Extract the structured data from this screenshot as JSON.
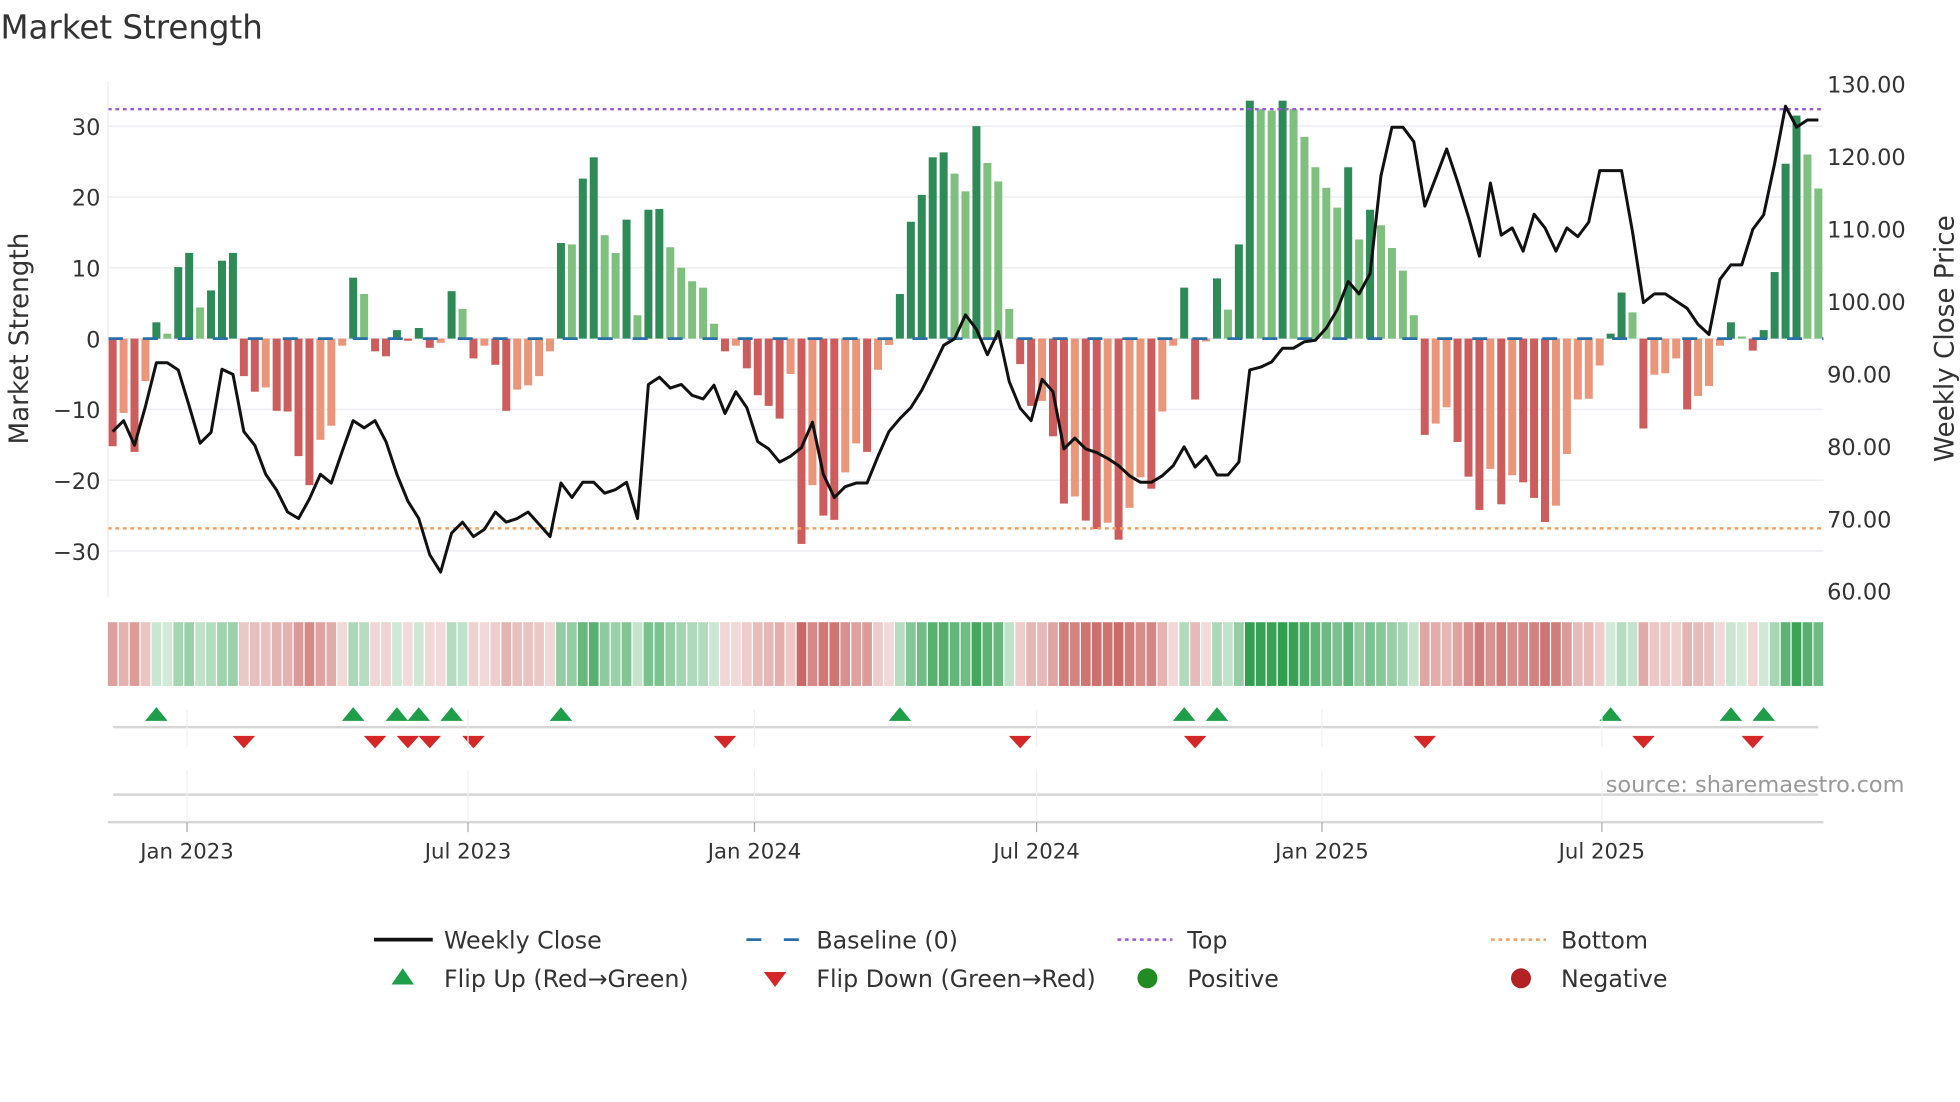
{
  "chart_data": {
    "type": "bar",
    "title": "Market Strength",
    "ylabel": "Market Strength",
    "y2label": "Weekly Close Price",
    "ylim": [
      -36,
      36
    ],
    "y2lim": [
      60,
      130
    ],
    "y_ticks": [
      -30,
      -20,
      -10,
      0,
      10,
      20,
      30
    ],
    "y2_ticks": [
      "60.00",
      "70.00",
      "80.00",
      "90.00",
      "100.00",
      "110.00",
      "120.00",
      "130.00"
    ],
    "x_ticks": [
      {
        "label": "Jan 2023",
        "week": 6.8
      },
      {
        "label": "Jul 2023",
        "week": 32.5
      },
      {
        "label": "Jan 2024",
        "week": 58.7
      },
      {
        "label": "Jul 2024",
        "week": 84.5
      },
      {
        "label": "Jan 2025",
        "week": 110.6
      },
      {
        "label": "Jul 2025",
        "week": 136.2
      }
    ],
    "top_level": 32.4,
    "bottom_level": -26.8,
    "baseline": 0,
    "strength": [
      -15.2,
      -10.5,
      -16,
      -6,
      2.3,
      0.7,
      10.1,
      12.1,
      4.4,
      6.8,
      11,
      12.1,
      -5.3,
      -7.5,
      -6.9,
      -10.2,
      -10.3,
      -16.6,
      -20.7,
      -14.3,
      -12.3,
      -1,
      8.6,
      6.3,
      -1.8,
      -2.5,
      1.2,
      -0.3,
      1.5,
      -1.3,
      -0.6,
      6.7,
      4.2,
      -2.8,
      -1,
      -3.7,
      -10.2,
      -7.2,
      -6.6,
      -5.3,
      -1.8,
      13.5,
      13.3,
      22.6,
      25.6,
      14.6,
      12.1,
      16.8,
      3.3,
      18.2,
      18.3,
      12.9,
      10,
      8.1,
      7.2,
      2.1,
      -1.8,
      -1,
      -4.2,
      -8,
      -9.5,
      -11.3,
      -5,
      -29,
      -20.7,
      -25,
      -25.6,
      -18.9,
      -14.8,
      -16,
      -4.4,
      -0.9,
      6.3,
      16.5,
      20.3,
      25.6,
      26.3,
      23.3,
      20.8,
      30,
      24.8,
      22.2,
      4.2,
      -3.6,
      -9.5,
      -8.8,
      -13.8,
      -23.3,
      -22.3,
      -25.7,
      -26.9,
      -26,
      -28.4,
      -23.9,
      -19.6,
      -21.2,
      -10.3,
      -1,
      7.2,
      -8.6,
      -0.4,
      8.5,
      4.1,
      13.3,
      33.6,
      32.4,
      32.2,
      33.6,
      32.4,
      28.5,
      24.2,
      21.3,
      18.5,
      24.2,
      14,
      18.2,
      16,
      12.8,
      9.6,
      3.3,
      -13.6,
      -12,
      -9.7,
      -14.6,
      -19.5,
      -24.2,
      -18.4,
      -23.4,
      -19.3,
      -20.3,
      -22.5,
      -25.9,
      -23.6,
      -16.3,
      -8.6,
      -8.5,
      -3.8,
      0.7,
      6.5,
      3.7,
      -12.7,
      -5.1,
      -4.9,
      -2.8,
      -10,
      -8.1,
      -6.7,
      -1,
      2.3,
      0.3,
      -1.7,
      1.2,
      9.4,
      24.7,
      31.5,
      26,
      21.2
    ],
    "weekly_close": [
      82,
      83.5,
      80.1,
      85.5,
      91.5,
      91.5,
      90.5,
      85.5,
      80.4,
      81.9,
      90.6,
      89.9,
      82,
      80.1,
      76.1,
      73.9,
      70.9,
      70,
      72.7,
      76.1,
      74.9,
      79.3,
      83.5,
      82.5,
      83.5,
      80.6,
      76.1,
      72.4,
      70,
      65,
      62.6,
      68,
      69.5,
      67.5,
      68.5,
      70.9,
      69.5,
      70,
      70.9,
      69.2,
      67.5,
      74.9,
      72.9,
      75,
      75,
      73.5,
      74,
      75,
      70,
      88.5,
      89.5,
      88,
      88.5,
      87,
      86.5,
      88.4,
      84.5,
      87.5,
      85.3,
      80.6,
      79.6,
      77.8,
      78.6,
      79.8,
      83.3,
      76.1,
      72.9,
      74.4,
      74.9,
      74.9,
      78.6,
      82,
      83.8,
      85.3,
      87.7,
      90.7,
      93.9,
      94.8,
      98.1,
      96.1,
      92.6,
      95.8,
      88.9,
      85.2,
      83.5,
      89.2,
      87.5,
      79.6,
      81.1,
      79.6,
      79.1,
      78.3,
      77.3,
      75.9,
      75,
      75,
      75.9,
      77.3,
      79.9,
      77.1,
      78.6,
      76,
      76,
      77.8,
      90.5,
      90.9,
      91.6,
      93.5,
      93.5,
      94.4,
      94.6,
      96.3,
      98.8,
      102.7,
      101,
      103.8,
      117.3,
      124,
      124,
      122,
      113.1,
      117,
      121,
      116.5,
      111.6,
      106.2,
      116.3,
      109.1,
      110.1,
      106.9,
      112,
      110.1,
      106.9,
      110.1,
      108.9,
      110.9,
      118,
      118,
      118,
      109.6,
      99.8,
      101,
      101,
      100,
      99,
      96.8,
      95.4,
      103,
      105,
      105,
      109.9,
      111.9,
      119,
      126.9,
      124,
      125,
      125
    ],
    "legend": [
      {
        "label": "Weekly Close",
        "kind": "line",
        "color": "#111111"
      },
      {
        "label": "Baseline (0)",
        "kind": "dash",
        "color": "#2a6fa8"
      },
      {
        "label": "Top",
        "kind": "dot",
        "color": "#9b59d6"
      },
      {
        "label": "Bottom",
        "kind": "dot",
        "color": "#f0a060"
      },
      {
        "label": "Flip Up (Red→Green)",
        "kind": "tri-up",
        "color": "#1e9e48"
      },
      {
        "label": "Flip Down (Green→Red)",
        "kind": "tri-down",
        "color": "#d62728"
      },
      {
        "label": "Positive",
        "kind": "circle",
        "color": "#228b22"
      },
      {
        "label": "Negative",
        "kind": "circle",
        "color": "#b22222"
      }
    ],
    "colors": {
      "pos_rising": "#2e8b57",
      "pos_falling": "#7fc07f",
      "neg_falling": "#cd5c5c",
      "neg_rising": "#e9967a"
    },
    "source": "source: sharemaestro.com"
  }
}
